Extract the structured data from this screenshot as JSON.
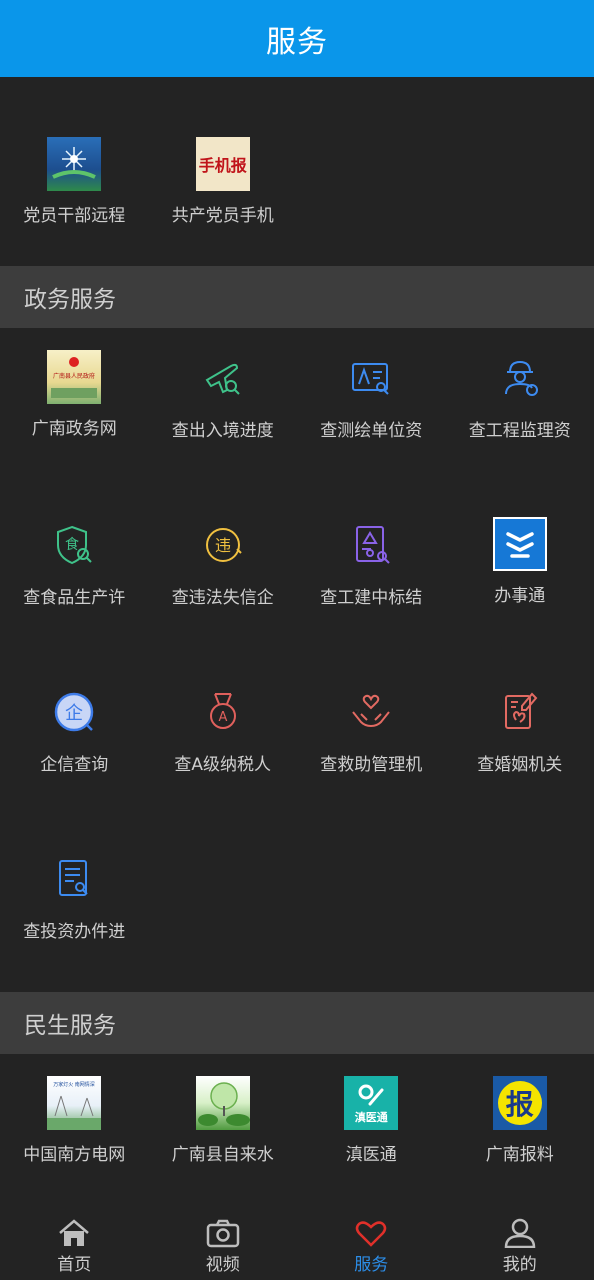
{
  "header": {
    "title": "服务"
  },
  "top_apps": [
    {
      "label": "党员干部远程",
      "icon": "starburst-logo-icon"
    },
    {
      "label": "共产党员手机",
      "icon": "mobile-news-logo-icon",
      "logo_text": "手机报"
    }
  ],
  "sections": [
    {
      "title": "政务服务",
      "items": [
        {
          "label": "广南政务网",
          "icon": "gov-portal-logo-icon",
          "logo_text": "广南县人民政府"
        },
        {
          "label": "查出入境进度",
          "icon": "airplane-search-icon",
          "color": "#3fc28a"
        },
        {
          "label": "查测绘单位资",
          "icon": "survey-document-icon",
          "color": "#3d8bf0"
        },
        {
          "label": "查工程监理资",
          "icon": "engineer-helmet-icon",
          "color": "#3d8bf0"
        },
        {
          "label": "查食品生产许",
          "icon": "food-shield-icon",
          "color": "#3fc28a",
          "glyph": "食"
        },
        {
          "label": "查违法失信企",
          "icon": "violation-badge-icon",
          "color": "#f0c040",
          "glyph": "违"
        },
        {
          "label": "查工建中标结",
          "icon": "bid-document-icon",
          "color": "#8a63e8"
        },
        {
          "label": "办事通",
          "icon": "banshitong-logo-icon",
          "color": "#1678d6"
        },
        {
          "label": "企信查询",
          "icon": "enterprise-house-icon",
          "color": "#3d7be8",
          "glyph": "企"
        },
        {
          "label": "查A级纳税人",
          "icon": "medal-a-icon",
          "color": "#e0605c",
          "glyph": "A"
        },
        {
          "label": "查救助管理机",
          "icon": "helping-hands-heart-icon",
          "color": "#e26a62"
        },
        {
          "label": "查婚姻机关",
          "icon": "marriage-certificate-icon",
          "color": "#e26a62"
        },
        {
          "label": "查投资办件进",
          "icon": "investment-document-icon",
          "color": "#3d8bf0"
        }
      ]
    },
    {
      "title": "民生服务",
      "items": [
        {
          "label": "中国南方电网",
          "icon": "power-grid-logo-icon",
          "logo_text": "万家灯火 南网情深"
        },
        {
          "label": "广南县自来水",
          "icon": "water-service-logo-icon"
        },
        {
          "label": "滇医通",
          "icon": "dianyitong-logo-icon",
          "logo_text": "滇医通"
        },
        {
          "label": "广南报料",
          "icon": "news-tip-logo-icon",
          "logo_text": "报"
        }
      ]
    }
  ],
  "tabbar": [
    {
      "label": "首页",
      "icon": "home-icon",
      "active": false
    },
    {
      "label": "视频",
      "icon": "camera-icon",
      "active": false
    },
    {
      "label": "服务",
      "icon": "heart-icon",
      "active": true
    },
    {
      "label": "我的",
      "icon": "person-icon",
      "active": false
    }
  ]
}
